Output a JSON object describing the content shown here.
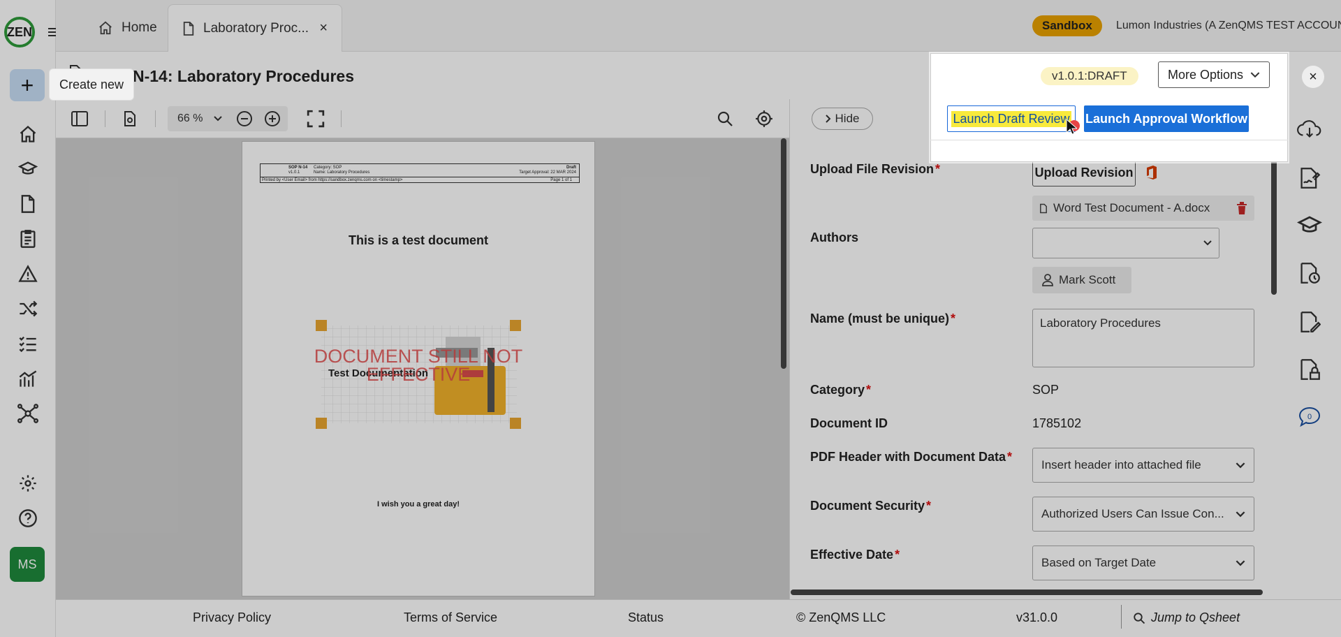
{
  "nav": {
    "logo_text": "ZEN",
    "create_tooltip": "Create new",
    "avatar_initials": "MS"
  },
  "tabs": {
    "home_label": "Home",
    "doc_label": "Laboratory Proc...",
    "close_glyph": "×"
  },
  "header": {
    "sandbox_label": "Sandbox",
    "account_label": "Lumon Industries (A ZenQMS TEST ACCOUNT)",
    "page_title": "N-14: Laboratory Procedures"
  },
  "viewer": {
    "zoom_value": "66 %",
    "document": {
      "header_code": "SOP N-14",
      "header_version": "v1.0.1",
      "header_category": "Category: SOP",
      "header_name": "Name: Laboratory Procedures",
      "header_status": "Draft",
      "header_target": "Target Approval: 22 MAR 2024",
      "header_printed": "Printed by <User Email> from https://sandbox.zenqms.com on <timestamp>",
      "header_page": "Page 1 of 1",
      "heading": "This is a test document",
      "watermark": "DOCUMENT STILL NOT EFFECTIVE",
      "illustration_label": "Test Documentation",
      "footer_text": "I wish you a great day!"
    }
  },
  "popup": {
    "version_badge": "v1.0.1:DRAFT",
    "more_options": "More Options",
    "launch_draft_review": "Launch Draft Review",
    "launch_approval_workflow": "Launch Approval Workflow"
  },
  "panel": {
    "hide_label": "Hide",
    "upload_label": "Upload File Revision",
    "upload_button": "Upload Revision",
    "file_name": "Word Test Document - A.docx",
    "authors_label": "Authors",
    "author_name": "Mark Scott",
    "name_label": "Name (must be unique)",
    "name_value": "Laboratory Procedures",
    "category_label": "Category",
    "category_value": "SOP",
    "doc_id_label": "Document ID",
    "doc_id_value": "1785102",
    "pdf_header_label": "PDF Header with Document Data",
    "pdf_header_value": "Insert header into attached file",
    "security_label": "Document Security",
    "security_value": "Authorized Users Can Issue Con...",
    "effective_label": "Effective Date",
    "effective_value": "Based on Target Date",
    "required_mark": "*"
  },
  "rail": {
    "comment_count": "0"
  },
  "footer": {
    "privacy": "Privacy Policy",
    "terms": "Terms of Service",
    "status": "Status",
    "copyright": "© ZenQMS LLC",
    "version": "v31.0.0",
    "jump_placeholder": "Jump to Qsheet"
  }
}
